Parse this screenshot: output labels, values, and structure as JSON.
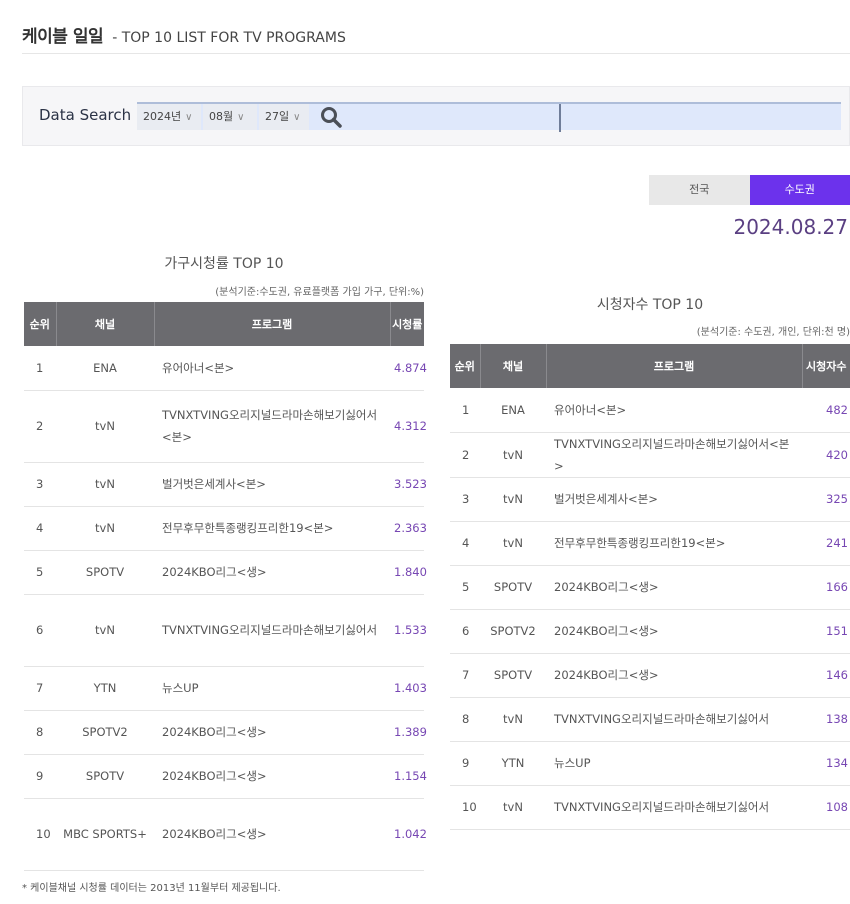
{
  "header": {
    "title_ko": "케이블 일일",
    "title_en": "- TOP 10 LIST FOR TV PROGRAMS"
  },
  "search": {
    "label": "Data Search",
    "year": "2024년",
    "month": "08월",
    "day": "27일",
    "search_icon": "search-icon"
  },
  "region_tabs": [
    {
      "label": "전국",
      "active": false
    },
    {
      "label": "수도권",
      "active": true
    }
  ],
  "selected_date": "2024.08.27",
  "colors": {
    "accent": "#6c32ec",
    "value_text": "#7747b3",
    "date_text": "#5a3f82",
    "table_header_bg": "#6b6b6f"
  },
  "household_rating": {
    "title": "가구시청률 TOP 10",
    "note": "(분석기준:수도권, 유료플랫폼 가입 가구, 단위:%)",
    "columns": [
      "순위",
      "채널",
      "프로그램",
      "시청률"
    ],
    "rows": [
      {
        "rank": "1",
        "channel": "ENA",
        "program": "유어아너<본>",
        "value": "4.874"
      },
      {
        "rank": "2",
        "channel": "tvN",
        "program": "TVNXTVING오리지널드라마손해보기싫어서<본>",
        "value": "4.312"
      },
      {
        "rank": "3",
        "channel": "tvN",
        "program": "벌거벗은세계사<본>",
        "value": "3.523"
      },
      {
        "rank": "4",
        "channel": "tvN",
        "program": "전무후무한특종랭킹프리한19<본>",
        "value": "2.363"
      },
      {
        "rank": "5",
        "channel": "SPOTV",
        "program": "2024KBO리그<생>",
        "value": "1.840"
      },
      {
        "rank": "6",
        "channel": "tvN",
        "program": "TVNXTVING오리지널드라마손해보기싫어서",
        "value": "1.533"
      },
      {
        "rank": "7",
        "channel": "YTN",
        "program": "뉴스UP",
        "value": "1.403"
      },
      {
        "rank": "8",
        "channel": "SPOTV2",
        "program": "2024KBO리그<생>",
        "value": "1.389"
      },
      {
        "rank": "9",
        "channel": "SPOTV",
        "program": "2024KBO리그<생>",
        "value": "1.154"
      },
      {
        "rank": "10",
        "channel": "MBC SPORTS+",
        "program": "2024KBO리그<생>",
        "value": "1.042"
      }
    ]
  },
  "viewers": {
    "title": "시청자수 TOP 10",
    "note": "(분석기준: 수도권, 개인, 단위:천 명)",
    "columns": [
      "순위",
      "채널",
      "프로그램",
      "시청자수"
    ],
    "rows": [
      {
        "rank": "1",
        "channel": "ENA",
        "program": "유어아너<본>",
        "value": "482"
      },
      {
        "rank": "2",
        "channel": "tvN",
        "program": "TVNXTVING오리지널드라마손해보기싫어서<본>",
        "value": "420"
      },
      {
        "rank": "3",
        "channel": "tvN",
        "program": "벌거벗은세계사<본>",
        "value": "325"
      },
      {
        "rank": "4",
        "channel": "tvN",
        "program": "전무후무한특종랭킹프리한19<본>",
        "value": "241"
      },
      {
        "rank": "5",
        "channel": "SPOTV",
        "program": "2024KBO리그<생>",
        "value": "166"
      },
      {
        "rank": "6",
        "channel": "SPOTV2",
        "program": "2024KBO리그<생>",
        "value": "151"
      },
      {
        "rank": "7",
        "channel": "SPOTV",
        "program": "2024KBO리그<생>",
        "value": "146"
      },
      {
        "rank": "8",
        "channel": "tvN",
        "program": "TVNXTVING오리지널드라마손해보기싫어서",
        "value": "138"
      },
      {
        "rank": "9",
        "channel": "YTN",
        "program": "뉴스UP",
        "value": "134"
      },
      {
        "rank": "10",
        "channel": "tvN",
        "program": "TVNXTVING오리지널드라마손해보기싫어서",
        "value": "108"
      }
    ]
  },
  "footnote": "* 케이블채널 시청률 데이터는 2013년 11월부터 제공됩니다."
}
